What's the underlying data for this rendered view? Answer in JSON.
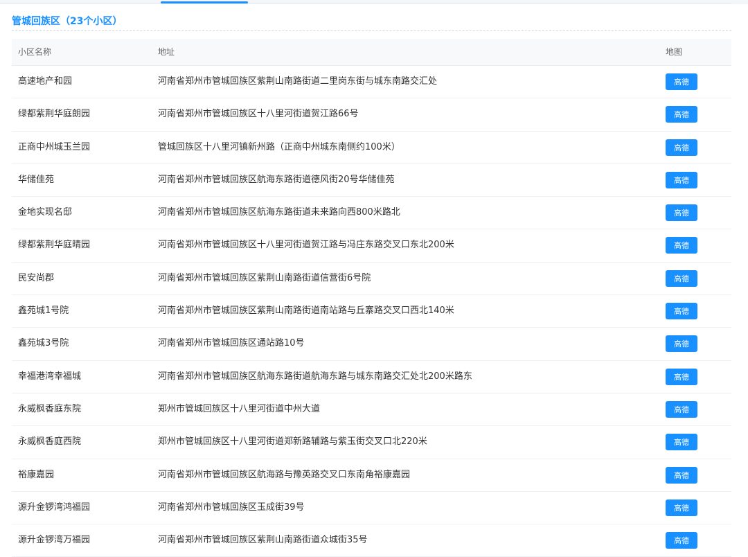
{
  "section": {
    "title": "管城回族区（23个小区）"
  },
  "table": {
    "headers": {
      "name": "小区名称",
      "address": "地址",
      "map": "地图"
    },
    "button_label": "高德",
    "rows": [
      {
        "name": "高速地产和园",
        "address": "河南省郑州市管城回族区紫荆山南路街道二里岗东街与城东南路交汇处"
      },
      {
        "name": "绿都紫荆华庭朗园",
        "address": "河南省郑州市管城回族区十八里河街道贺江路66号"
      },
      {
        "name": "正商中州城玉兰园",
        "address": "管城回族区十八里河镇新州路（正商中州城东南侧约100米）"
      },
      {
        "name": "华储佳苑",
        "address": "河南省郑州市管城回族区航海东路街道德风街20号华储佳苑"
      },
      {
        "name": "金地实现名邸",
        "address": "河南省郑州市管城回族区航海东路街道未来路向西800米路北"
      },
      {
        "name": "绿都紫荆华庭晴园",
        "address": "河南省郑州市管城回族区十八里河街道贺江路与冯庄东路交叉口东北200米"
      },
      {
        "name": "民安尚郡",
        "address": "河南省郑州市管城回族区紫荆山南路街道信营街6号院"
      },
      {
        "name": "鑫苑城1号院",
        "address": "河南省郑州市管城回族区紫荆山南路街道南站路与丘寨路交叉口西北140米"
      },
      {
        "name": "鑫苑城3号院",
        "address": "河南省郑州市管城回族区通站路10号"
      },
      {
        "name": "幸福港湾幸福城",
        "address": "河南省郑州市管城回族区航海东路街道航海东路与城东南路交汇处北200米路东"
      },
      {
        "name": "永威枫香庭东院",
        "address": "郑州市管城回族区十八里河街道中州大道"
      },
      {
        "name": "永威枫香庭西院",
        "address": "郑州市管城回族区十八里河街道郑新路辅路与紫玉街交叉口北220米"
      },
      {
        "name": "裕康嘉园",
        "address": "河南省郑州市管城回族区航海路与豫英路交叉口东南角裕康嘉园"
      },
      {
        "name": "源升金锣湾鸿福园",
        "address": "河南省郑州市管城回族区玉成街39号"
      },
      {
        "name": "源升金锣湾万福园",
        "address": "河南省郑州市管城回族区紫荆山南路街道众城街35号"
      }
    ]
  },
  "colors": {
    "accent": "#1890ff"
  }
}
